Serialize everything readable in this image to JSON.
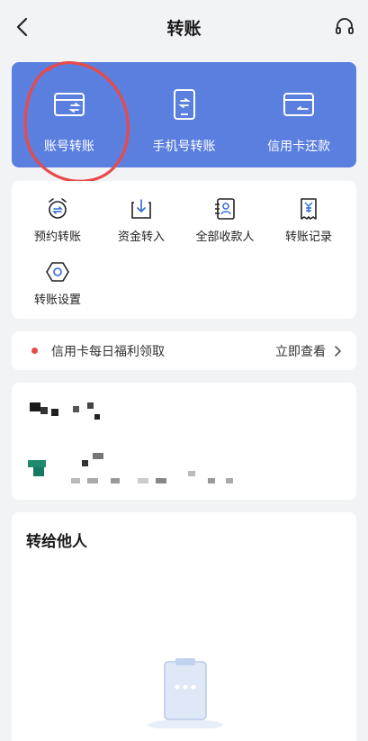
{
  "header": {
    "title": "转账"
  },
  "banner": {
    "items": [
      {
        "label": "账号转账",
        "icon": "bank-card-transfer-icon"
      },
      {
        "label": "手机号转账",
        "icon": "phone-transfer-icon"
      },
      {
        "label": "信用卡还款",
        "icon": "credit-card-repay-icon"
      }
    ]
  },
  "shortcuts": {
    "items": [
      {
        "label": "预约转账",
        "icon": "alarm-clock-icon"
      },
      {
        "label": "资金转入",
        "icon": "download-tray-icon"
      },
      {
        "label": "全部收款人",
        "icon": "contacts-icon"
      },
      {
        "label": "转账记录",
        "icon": "receipt-icon"
      },
      {
        "label": "转账设置",
        "icon": "settings-hexagon-icon"
      }
    ]
  },
  "promo": {
    "text": "信用卡每日福利领取",
    "link": "立即查看"
  },
  "transfer_others": {
    "title": "转给他人"
  },
  "colors": {
    "accent": "#5b7fdf",
    "annotation": "#e84a4a",
    "dot": "#e64b4b"
  }
}
